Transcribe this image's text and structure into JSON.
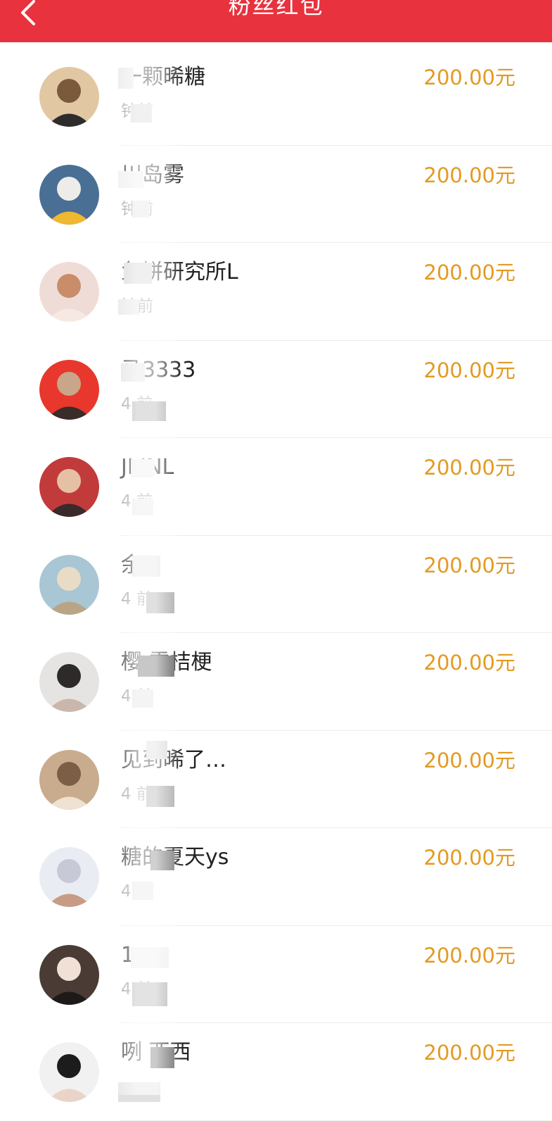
{
  "header": {
    "title": "粉丝红包",
    "background": "#e8323d"
  },
  "colors": {
    "amount": "#e39a22",
    "name": "#222222",
    "time": "#999999"
  },
  "rows": [
    {
      "name": "一颗晞糖",
      "time": "钟前",
      "amount": "200.00元",
      "avatar": [
        "#e2c7a3",
        "#7a5a3a",
        "#2d2d2d"
      ]
    },
    {
      "name": "川岛雾",
      "time": "钟前",
      "amount": "200.00元",
      "avatar": [
        "#4a6f95",
        "#eeece8",
        "#f0b731"
      ]
    },
    {
      "name": "鱼饼研究所L",
      "time": "钟前",
      "amount": "200.00元",
      "avatar": [
        "#f0dcd6",
        "#c98d6a",
        "#f6e9e4"
      ]
    },
    {
      "name": "马3333",
      "time": "4 前",
      "amount": "200.00元",
      "avatar": [
        "#e8372d",
        "#c9a58a",
        "#3a2c28"
      ]
    },
    {
      "name": "JI INL",
      "time": "4 前",
      "amount": "200.00元",
      "avatar": [
        "#c23b3b",
        "#e6c0a5",
        "#3a2a2a"
      ]
    },
    {
      "name": "余",
      "time": "4 前",
      "amount": "200.00元",
      "avatar": [
        "#a8c6d4",
        "#e9dcc6",
        "#b9a586"
      ]
    },
    {
      "name": "樱 雪桔梗",
      "time": "4 前",
      "amount": "200.00元",
      "avatar": [
        "#e6e4e2",
        "#2e2a2a",
        "#c8b7aa"
      ]
    },
    {
      "name": "见到晞了…",
      "time": "4 前",
      "amount": "200.00元",
      "avatar": [
        "#c9ab8d",
        "#7c5e47",
        "#efe2d3"
      ]
    },
    {
      "name": "糖的夏天ys",
      "time": "4 前",
      "amount": "200.00元",
      "avatar": [
        "#e9ecf2",
        "#c7c9d6",
        "#c79b86"
      ]
    },
    {
      "name": "1 一",
      "time": "4 前",
      "amount": "200.00元",
      "avatar": [
        "#4a3b35",
        "#f1e0d6",
        "#1e1a1a"
      ]
    },
    {
      "name": "咧 西西",
      "time": "",
      "amount": "200.00元",
      "avatar": [
        "#f1f1f1",
        "#1c1c1c",
        "#e9d4c7"
      ]
    }
  ]
}
